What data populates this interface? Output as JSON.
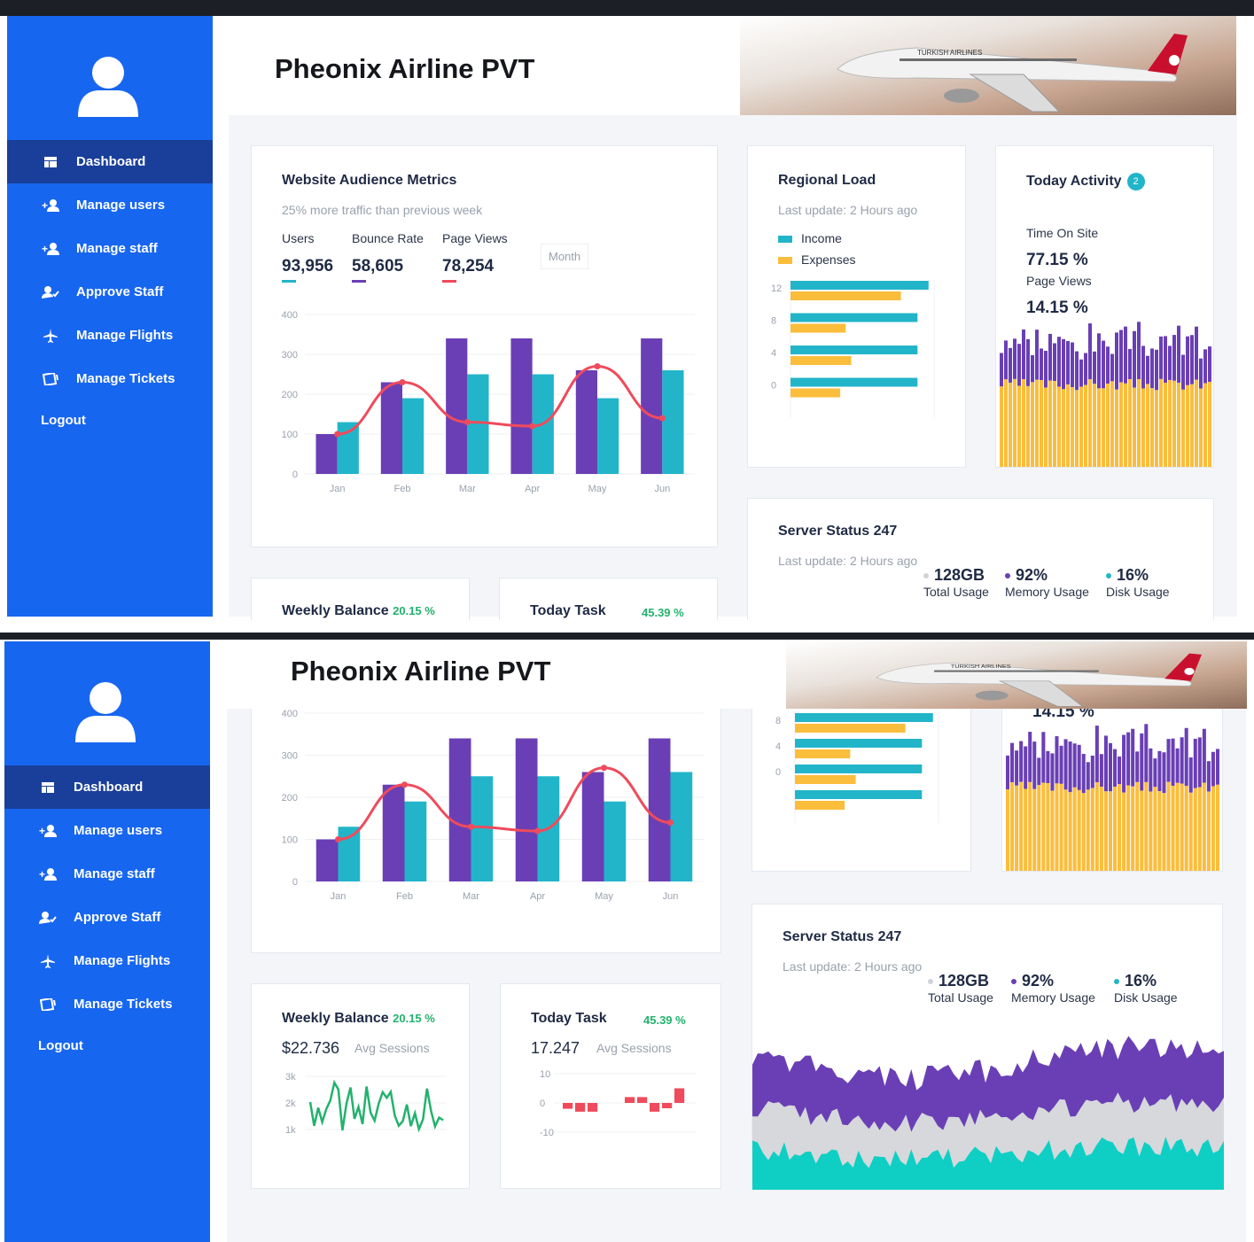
{
  "app": {
    "title": "Pheonix Airline PVT",
    "banner_airline": "TURKISH AIRLINES"
  },
  "sidebar": {
    "items": [
      {
        "label": "Dashboard",
        "icon": "dashboard-icon",
        "active": true
      },
      {
        "label": "Manage users",
        "icon": "add-user-icon"
      },
      {
        "label": "Manage staff",
        "icon": "add-staff-icon"
      },
      {
        "label": "Approve Staff",
        "icon": "approve-user-icon"
      },
      {
        "label": "Manage Flights",
        "icon": "airplane-icon"
      },
      {
        "label": "Manage Tickets",
        "icon": "ticket-icon"
      }
    ],
    "logout": "Logout"
  },
  "audience": {
    "title": "Website Audience Metrics",
    "subtitle": "25% more traffic than previous week",
    "stats": [
      {
        "label": "Users",
        "value": "93,956",
        "color": "#22b5c9"
      },
      {
        "label": "Bounce Rate",
        "value": "58,605",
        "color": "#6a3fb5"
      },
      {
        "label": "Page Views",
        "value": "78,254",
        "color": "#ef4b5c"
      }
    ],
    "period": "Month"
  },
  "regional": {
    "title": "Regional Load",
    "subtitle": "Last update: 2 Hours ago",
    "legend": [
      {
        "label": "Income",
        "color": "#22b5c9"
      },
      {
        "label": "Expenses",
        "color": "#fbbd3c"
      }
    ]
  },
  "activity": {
    "title": "Today Activity",
    "badge": "2",
    "time_label": "Time On Site",
    "time_value": "77.15 %",
    "views_label": "Page Views",
    "views_value": "14.15 %"
  },
  "server": {
    "title": "Server Status 247",
    "subtitle": "Last update: 2 Hours ago",
    "stats": [
      {
        "value": "128GB",
        "label": "Total Usage",
        "color": "#cfd3d9"
      },
      {
        "value": "92%",
        "label": "Memory Usage",
        "color": "#6a3fb5"
      },
      {
        "value": "16%",
        "label": "Disk Usage",
        "color": "#22b5c9"
      }
    ]
  },
  "weekly": {
    "title": "Weekly Balance",
    "change": "20.15 %",
    "value": "$22.736",
    "sub": "Avg Sessions"
  },
  "task": {
    "title": "Today Task",
    "change": "45.39 %",
    "value": "17.247",
    "sub": "Avg Sessions"
  },
  "colors": {
    "sidebar": "#1766f0",
    "sidebar_active": "#1a3f9a",
    "purple": "#6a3fb5",
    "teal": "#22b5c9",
    "red": "#ef4b5c",
    "yellow": "#fbbd3c",
    "green": "#23b26d"
  },
  "chart_data": [
    {
      "type": "bar",
      "name_ref": "audience",
      "categories": [
        "Jan",
        "Feb",
        "Mar",
        "Apr",
        "May",
        "Jun"
      ],
      "series": [
        {
          "values": [
            100,
            230,
            340,
            340,
            260,
            340
          ]
        },
        {
          "values": [
            130,
            190,
            250,
            250,
            190,
            260
          ]
        },
        {
          "values": [
            100,
            230,
            130,
            120,
            270,
            140
          ]
        }
      ],
      "yticks": [
        0,
        100,
        200,
        300,
        400
      ],
      "ylim": [
        0,
        400
      ]
    },
    {
      "type": "bar",
      "name_ref": "regional",
      "orientation": "horizontal",
      "yticks": [
        12,
        8,
        4,
        0
      ],
      "series": [
        {
          "name": "Income",
          "values": [
            12.5,
            11.5,
            11.5,
            11.5
          ]
        },
        {
          "name": "Expenses",
          "values": [
            10,
            5,
            5.5,
            4.5
          ]
        }
      ]
    },
    {
      "type": "bar",
      "name_ref": "activity",
      "stacked": true
    },
    {
      "type": "area",
      "name_ref": "server",
      "stacked": true
    },
    {
      "type": "line",
      "name_ref": "weekly",
      "yticks": [
        "3k",
        "2k",
        "1k"
      ]
    },
    {
      "type": "bar",
      "name_ref": "task",
      "yticks": [
        10,
        0,
        -10
      ],
      "values": [
        -2,
        -3,
        -3,
        0,
        0,
        2,
        2,
        -3,
        -1,
        5
      ],
      "ylim": [
        -10,
        10
      ]
    }
  ]
}
